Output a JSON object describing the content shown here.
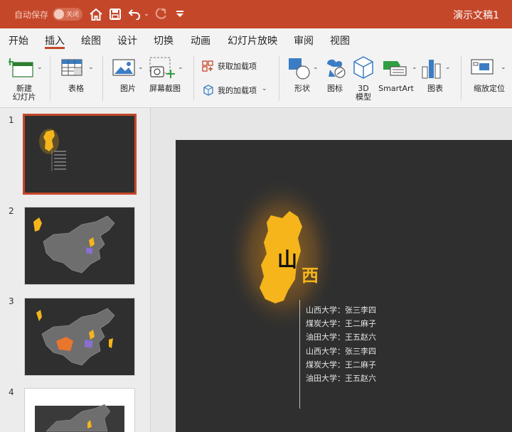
{
  "titlebar": {
    "autosave_label": "自动保存",
    "autosave_toggle": "关闭",
    "doc_title": "演示文稿1"
  },
  "tabs": [
    "开始",
    "插入",
    "绘图",
    "设计",
    "切换",
    "动画",
    "幻灯片放映",
    "审阅",
    "视图"
  ],
  "ribbon": {
    "new_slide_line1": "新建",
    "new_slide_line2": "幻灯片",
    "table": "表格",
    "picture": "图片",
    "screenshot": "屏幕截图",
    "get_addins": "获取加载项",
    "my_addins": "我的加载项",
    "shapes": "形状",
    "icons": "图标",
    "model3d_line1": "3D",
    "model3d_line2": "模型",
    "smartart": "SmartArt",
    "chart": "图表",
    "zoom": "缩放定位"
  },
  "thumbnails": [
    "1",
    "2",
    "3",
    "4"
  ],
  "slide": {
    "title_chars": [
      "山",
      "西"
    ],
    "lines": [
      "山西大学：张三李四",
      "煤炭大学：王二麻子",
      "油田大学：王五赵六",
      "山西大学：张三李四",
      "煤炭大学：王二麻子",
      "油田大学：王五赵六"
    ]
  },
  "colors": {
    "accent": "#c5472a",
    "province_yellow": "#f5b51b",
    "slide_bg": "#2f2f2f"
  }
}
